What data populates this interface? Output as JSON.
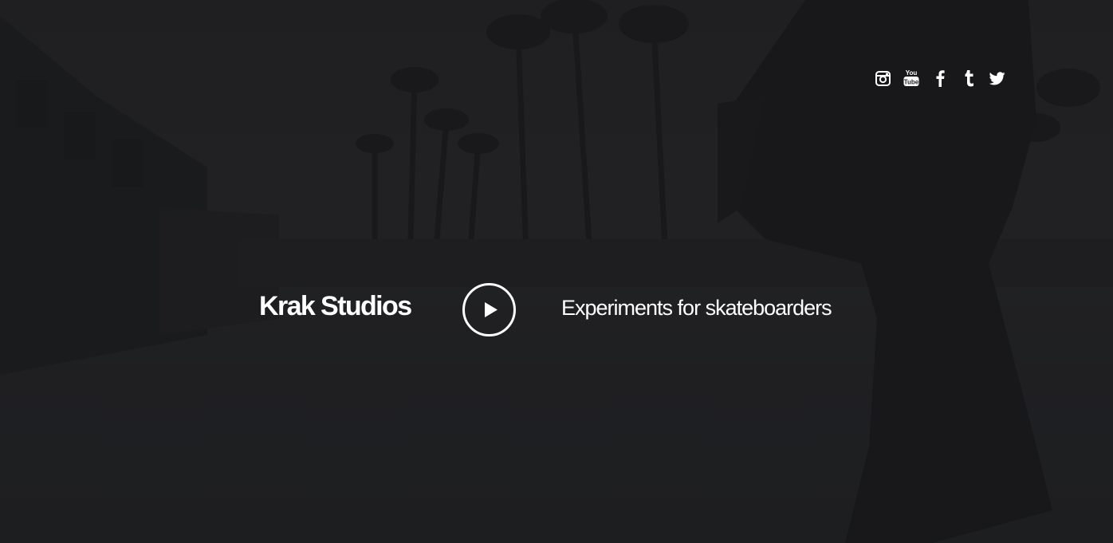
{
  "hero": {
    "brand": "Krak Studios",
    "tagline": "Experiments for skateboarders",
    "play_icon": "play-icon"
  },
  "social": {
    "items": [
      {
        "name": "instagram",
        "icon": "instagram-icon"
      },
      {
        "name": "youtube",
        "icon": "youtube-icon",
        "label_top": "You",
        "label_bottom": "Tube"
      },
      {
        "name": "facebook",
        "icon": "facebook-icon"
      },
      {
        "name": "tumblr",
        "icon": "tumblr-icon"
      },
      {
        "name": "twitter",
        "icon": "twitter-icon"
      }
    ]
  },
  "colors": {
    "background": "#222325",
    "foreground": "#ffffff"
  }
}
